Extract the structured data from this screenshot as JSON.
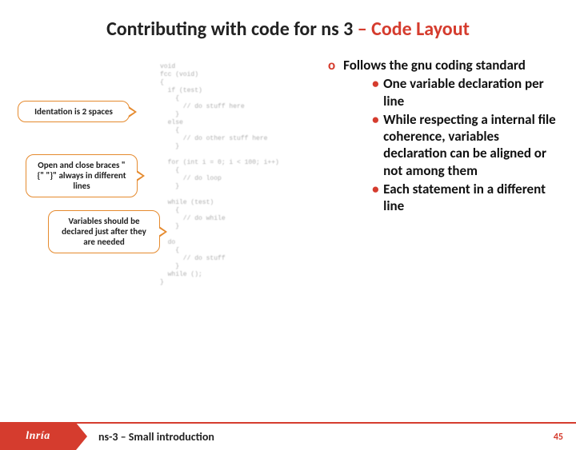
{
  "title_part1": "Contributing with code for ns 3 ",
  "title_part2": "– Code Layout",
  "callouts": {
    "indentation": "Identation is 2 spaces",
    "braces": "Open and close braces \"{\" \"}\" always in different lines",
    "variables": "Variables should be declared just after they are needed"
  },
  "bullets": {
    "o_mark": "o",
    "heading": "Follows the gnu coding standard",
    "items": [
      "One variable declaration per line",
      "While respecting a internal file coherence, variables declaration can be aligned or not among them",
      "Each statement in a different line"
    ]
  },
  "code_lines": [
    "void",
    "fcc (void)",
    "{",
    "  if (test)",
    "    {",
    "      // do stuff here",
    "    }",
    "  else",
    "    {",
    "      // do other stuff here",
    "    }",
    "",
    "  for (int i = 0; i < 100; i++)",
    "    {",
    "      // do loop",
    "    }",
    "",
    "  while (test)",
    "    {",
    "      // do while",
    "    }",
    "",
    "  do",
    "    {",
    "      // do stuff",
    "    }",
    "  while ();",
    "}"
  ],
  "footer": {
    "logo": "lnría",
    "title": "ns-3 – Small introduction",
    "page": "45"
  }
}
